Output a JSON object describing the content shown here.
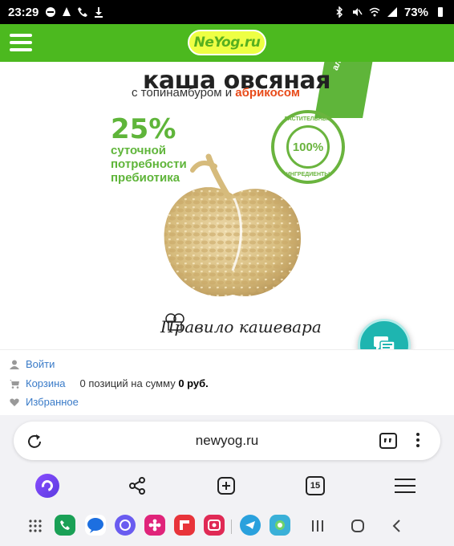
{
  "status_bar": {
    "time": "23:29",
    "battery": "73%"
  },
  "header": {
    "logo_text": "NeYog.ru"
  },
  "banner": {
    "title": "каша овсяная",
    "subtitle_prefix": "с топинамбуром и ",
    "subtitle_accent": "абрикосом",
    "percent": "25%",
    "percent_desc": [
      "суточной",
      "потребности",
      "пребиотика"
    ],
    "stamp_center": "100%",
    "stamp_top": "РАСТИТЕЛЬНЫЕ",
    "stamp_bottom": "ИНГРЕДИЕНТЫ",
    "ribbon_text": "альте",
    "signature": "Правило кашевара"
  },
  "account": {
    "login_label": "Войти",
    "cart_label": "Корзина",
    "cart_text_prefix": "0 позиций на сумму ",
    "cart_sum": "0 руб.",
    "favorites_label": "Избранное"
  },
  "browser": {
    "url": "newyog.ru",
    "tabs_count": "15"
  },
  "colors": {
    "brand_green": "#4cb91f",
    "fab_teal": "#1eb5b0",
    "link_blue": "#3a7bc8"
  }
}
